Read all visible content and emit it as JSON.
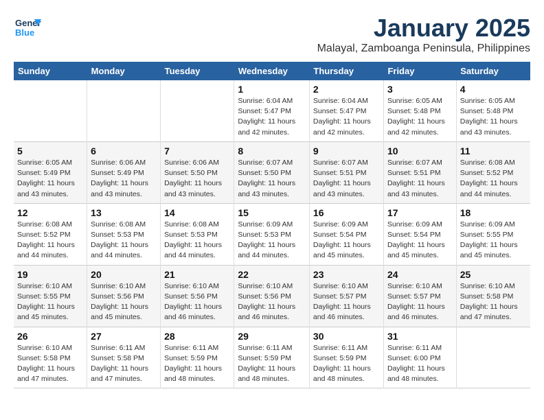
{
  "header": {
    "logo_line1": "General",
    "logo_line2": "Blue",
    "month": "January 2025",
    "location": "Malayal, Zamboanga Peninsula, Philippines"
  },
  "weekdays": [
    "Sunday",
    "Monday",
    "Tuesday",
    "Wednesday",
    "Thursday",
    "Friday",
    "Saturday"
  ],
  "weeks": [
    [
      {
        "num": "",
        "detail": ""
      },
      {
        "num": "",
        "detail": ""
      },
      {
        "num": "",
        "detail": ""
      },
      {
        "num": "1",
        "detail": "Sunrise: 6:04 AM\nSunset: 5:47 PM\nDaylight: 11 hours\nand 42 minutes."
      },
      {
        "num": "2",
        "detail": "Sunrise: 6:04 AM\nSunset: 5:47 PM\nDaylight: 11 hours\nand 42 minutes."
      },
      {
        "num": "3",
        "detail": "Sunrise: 6:05 AM\nSunset: 5:48 PM\nDaylight: 11 hours\nand 42 minutes."
      },
      {
        "num": "4",
        "detail": "Sunrise: 6:05 AM\nSunset: 5:48 PM\nDaylight: 11 hours\nand 43 minutes."
      }
    ],
    [
      {
        "num": "5",
        "detail": "Sunrise: 6:05 AM\nSunset: 5:49 PM\nDaylight: 11 hours\nand 43 minutes."
      },
      {
        "num": "6",
        "detail": "Sunrise: 6:06 AM\nSunset: 5:49 PM\nDaylight: 11 hours\nand 43 minutes."
      },
      {
        "num": "7",
        "detail": "Sunrise: 6:06 AM\nSunset: 5:50 PM\nDaylight: 11 hours\nand 43 minutes."
      },
      {
        "num": "8",
        "detail": "Sunrise: 6:07 AM\nSunset: 5:50 PM\nDaylight: 11 hours\nand 43 minutes."
      },
      {
        "num": "9",
        "detail": "Sunrise: 6:07 AM\nSunset: 5:51 PM\nDaylight: 11 hours\nand 43 minutes."
      },
      {
        "num": "10",
        "detail": "Sunrise: 6:07 AM\nSunset: 5:51 PM\nDaylight: 11 hours\nand 43 minutes."
      },
      {
        "num": "11",
        "detail": "Sunrise: 6:08 AM\nSunset: 5:52 PM\nDaylight: 11 hours\nand 44 minutes."
      }
    ],
    [
      {
        "num": "12",
        "detail": "Sunrise: 6:08 AM\nSunset: 5:52 PM\nDaylight: 11 hours\nand 44 minutes."
      },
      {
        "num": "13",
        "detail": "Sunrise: 6:08 AM\nSunset: 5:53 PM\nDaylight: 11 hours\nand 44 minutes."
      },
      {
        "num": "14",
        "detail": "Sunrise: 6:08 AM\nSunset: 5:53 PM\nDaylight: 11 hours\nand 44 minutes."
      },
      {
        "num": "15",
        "detail": "Sunrise: 6:09 AM\nSunset: 5:53 PM\nDaylight: 11 hours\nand 44 minutes."
      },
      {
        "num": "16",
        "detail": "Sunrise: 6:09 AM\nSunset: 5:54 PM\nDaylight: 11 hours\nand 45 minutes."
      },
      {
        "num": "17",
        "detail": "Sunrise: 6:09 AM\nSunset: 5:54 PM\nDaylight: 11 hours\nand 45 minutes."
      },
      {
        "num": "18",
        "detail": "Sunrise: 6:09 AM\nSunset: 5:55 PM\nDaylight: 11 hours\nand 45 minutes."
      }
    ],
    [
      {
        "num": "19",
        "detail": "Sunrise: 6:10 AM\nSunset: 5:55 PM\nDaylight: 11 hours\nand 45 minutes."
      },
      {
        "num": "20",
        "detail": "Sunrise: 6:10 AM\nSunset: 5:56 PM\nDaylight: 11 hours\nand 45 minutes."
      },
      {
        "num": "21",
        "detail": "Sunrise: 6:10 AM\nSunset: 5:56 PM\nDaylight: 11 hours\nand 46 minutes."
      },
      {
        "num": "22",
        "detail": "Sunrise: 6:10 AM\nSunset: 5:56 PM\nDaylight: 11 hours\nand 46 minutes."
      },
      {
        "num": "23",
        "detail": "Sunrise: 6:10 AM\nSunset: 5:57 PM\nDaylight: 11 hours\nand 46 minutes."
      },
      {
        "num": "24",
        "detail": "Sunrise: 6:10 AM\nSunset: 5:57 PM\nDaylight: 11 hours\nand 46 minutes."
      },
      {
        "num": "25",
        "detail": "Sunrise: 6:10 AM\nSunset: 5:58 PM\nDaylight: 11 hours\nand 47 minutes."
      }
    ],
    [
      {
        "num": "26",
        "detail": "Sunrise: 6:10 AM\nSunset: 5:58 PM\nDaylight: 11 hours\nand 47 minutes."
      },
      {
        "num": "27",
        "detail": "Sunrise: 6:11 AM\nSunset: 5:58 PM\nDaylight: 11 hours\nand 47 minutes."
      },
      {
        "num": "28",
        "detail": "Sunrise: 6:11 AM\nSunset: 5:59 PM\nDaylight: 11 hours\nand 48 minutes."
      },
      {
        "num": "29",
        "detail": "Sunrise: 6:11 AM\nSunset: 5:59 PM\nDaylight: 11 hours\nand 48 minutes."
      },
      {
        "num": "30",
        "detail": "Sunrise: 6:11 AM\nSunset: 5:59 PM\nDaylight: 11 hours\nand 48 minutes."
      },
      {
        "num": "31",
        "detail": "Sunrise: 6:11 AM\nSunset: 6:00 PM\nDaylight: 11 hours\nand 48 minutes."
      },
      {
        "num": "",
        "detail": ""
      }
    ]
  ]
}
